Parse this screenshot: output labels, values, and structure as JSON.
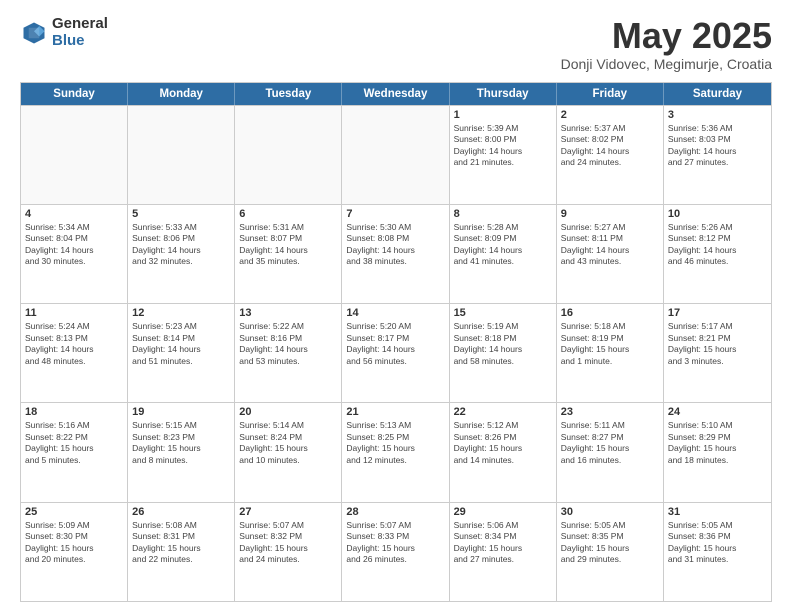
{
  "header": {
    "logo": {
      "general": "General",
      "blue": "Blue"
    },
    "title": "May 2025",
    "location": "Donji Vidovec, Megimurje, Croatia"
  },
  "calendar": {
    "days": [
      "Sunday",
      "Monday",
      "Tuesday",
      "Wednesday",
      "Thursday",
      "Friday",
      "Saturday"
    ],
    "weeks": [
      [
        {
          "date": "",
          "info": ""
        },
        {
          "date": "",
          "info": ""
        },
        {
          "date": "",
          "info": ""
        },
        {
          "date": "",
          "info": ""
        },
        {
          "date": "1",
          "info": "Sunrise: 5:39 AM\nSunset: 8:00 PM\nDaylight: 14 hours\nand 21 minutes."
        },
        {
          "date": "2",
          "info": "Sunrise: 5:37 AM\nSunset: 8:02 PM\nDaylight: 14 hours\nand 24 minutes."
        },
        {
          "date": "3",
          "info": "Sunrise: 5:36 AM\nSunset: 8:03 PM\nDaylight: 14 hours\nand 27 minutes."
        }
      ],
      [
        {
          "date": "4",
          "info": "Sunrise: 5:34 AM\nSunset: 8:04 PM\nDaylight: 14 hours\nand 30 minutes."
        },
        {
          "date": "5",
          "info": "Sunrise: 5:33 AM\nSunset: 8:06 PM\nDaylight: 14 hours\nand 32 minutes."
        },
        {
          "date": "6",
          "info": "Sunrise: 5:31 AM\nSunset: 8:07 PM\nDaylight: 14 hours\nand 35 minutes."
        },
        {
          "date": "7",
          "info": "Sunrise: 5:30 AM\nSunset: 8:08 PM\nDaylight: 14 hours\nand 38 minutes."
        },
        {
          "date": "8",
          "info": "Sunrise: 5:28 AM\nSunset: 8:09 PM\nDaylight: 14 hours\nand 41 minutes."
        },
        {
          "date": "9",
          "info": "Sunrise: 5:27 AM\nSunset: 8:11 PM\nDaylight: 14 hours\nand 43 minutes."
        },
        {
          "date": "10",
          "info": "Sunrise: 5:26 AM\nSunset: 8:12 PM\nDaylight: 14 hours\nand 46 minutes."
        }
      ],
      [
        {
          "date": "11",
          "info": "Sunrise: 5:24 AM\nSunset: 8:13 PM\nDaylight: 14 hours\nand 48 minutes."
        },
        {
          "date": "12",
          "info": "Sunrise: 5:23 AM\nSunset: 8:14 PM\nDaylight: 14 hours\nand 51 minutes."
        },
        {
          "date": "13",
          "info": "Sunrise: 5:22 AM\nSunset: 8:16 PM\nDaylight: 14 hours\nand 53 minutes."
        },
        {
          "date": "14",
          "info": "Sunrise: 5:20 AM\nSunset: 8:17 PM\nDaylight: 14 hours\nand 56 minutes."
        },
        {
          "date": "15",
          "info": "Sunrise: 5:19 AM\nSunset: 8:18 PM\nDaylight: 14 hours\nand 58 minutes."
        },
        {
          "date": "16",
          "info": "Sunrise: 5:18 AM\nSunset: 8:19 PM\nDaylight: 15 hours\nand 1 minute."
        },
        {
          "date": "17",
          "info": "Sunrise: 5:17 AM\nSunset: 8:21 PM\nDaylight: 15 hours\nand 3 minutes."
        }
      ],
      [
        {
          "date": "18",
          "info": "Sunrise: 5:16 AM\nSunset: 8:22 PM\nDaylight: 15 hours\nand 5 minutes."
        },
        {
          "date": "19",
          "info": "Sunrise: 5:15 AM\nSunset: 8:23 PM\nDaylight: 15 hours\nand 8 minutes."
        },
        {
          "date": "20",
          "info": "Sunrise: 5:14 AM\nSunset: 8:24 PM\nDaylight: 15 hours\nand 10 minutes."
        },
        {
          "date": "21",
          "info": "Sunrise: 5:13 AM\nSunset: 8:25 PM\nDaylight: 15 hours\nand 12 minutes."
        },
        {
          "date": "22",
          "info": "Sunrise: 5:12 AM\nSunset: 8:26 PM\nDaylight: 15 hours\nand 14 minutes."
        },
        {
          "date": "23",
          "info": "Sunrise: 5:11 AM\nSunset: 8:27 PM\nDaylight: 15 hours\nand 16 minutes."
        },
        {
          "date": "24",
          "info": "Sunrise: 5:10 AM\nSunset: 8:29 PM\nDaylight: 15 hours\nand 18 minutes."
        }
      ],
      [
        {
          "date": "25",
          "info": "Sunrise: 5:09 AM\nSunset: 8:30 PM\nDaylight: 15 hours\nand 20 minutes."
        },
        {
          "date": "26",
          "info": "Sunrise: 5:08 AM\nSunset: 8:31 PM\nDaylight: 15 hours\nand 22 minutes."
        },
        {
          "date": "27",
          "info": "Sunrise: 5:07 AM\nSunset: 8:32 PM\nDaylight: 15 hours\nand 24 minutes."
        },
        {
          "date": "28",
          "info": "Sunrise: 5:07 AM\nSunset: 8:33 PM\nDaylight: 15 hours\nand 26 minutes."
        },
        {
          "date": "29",
          "info": "Sunrise: 5:06 AM\nSunset: 8:34 PM\nDaylight: 15 hours\nand 27 minutes."
        },
        {
          "date": "30",
          "info": "Sunrise: 5:05 AM\nSunset: 8:35 PM\nDaylight: 15 hours\nand 29 minutes."
        },
        {
          "date": "31",
          "info": "Sunrise: 5:05 AM\nSunset: 8:36 PM\nDaylight: 15 hours\nand 31 minutes."
        }
      ]
    ]
  }
}
